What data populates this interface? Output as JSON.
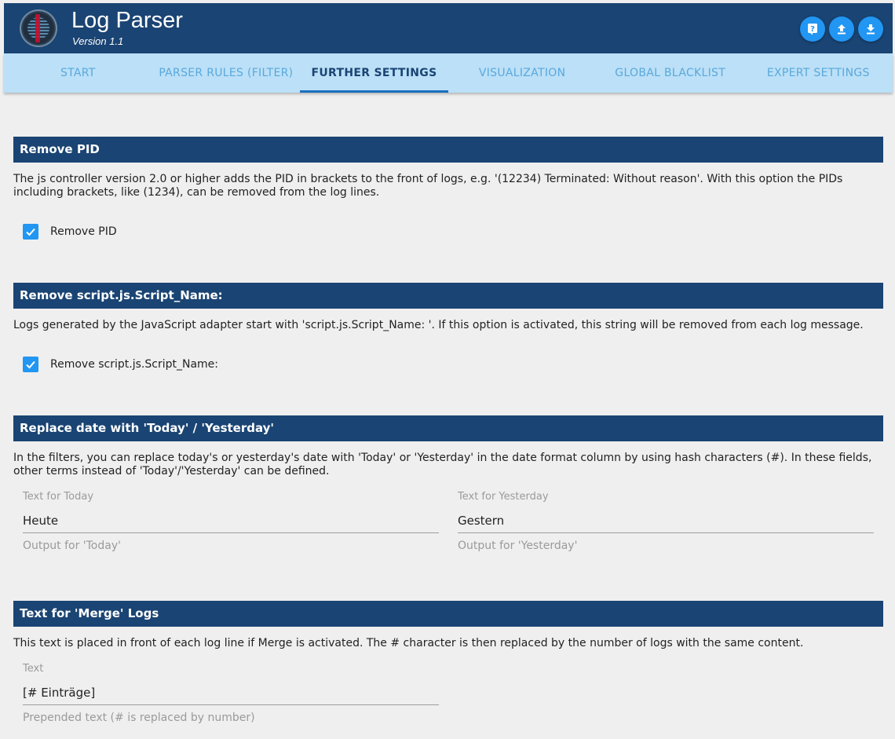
{
  "app": {
    "title": "Log Parser",
    "version": "Version 1.1"
  },
  "header_buttons": [
    {
      "name": "help",
      "icon": "help-icon"
    },
    {
      "name": "upload",
      "icon": "upload-icon"
    },
    {
      "name": "download",
      "icon": "download-icon"
    }
  ],
  "tabs": [
    {
      "label": "START",
      "active": false
    },
    {
      "label": "PARSER RULES (FILTER)",
      "active": false
    },
    {
      "label": "FURTHER SETTINGS",
      "active": true
    },
    {
      "label": "VISUALIZATION",
      "active": false
    },
    {
      "label": "GLOBAL BLACKLIST",
      "active": false
    },
    {
      "label": "EXPERT SETTINGS",
      "active": false
    }
  ],
  "sections": {
    "remove_pid": {
      "title": "Remove PID",
      "description": "The js controller version 2.0 or higher adds the PID in brackets to the front of logs, e.g. '(12234) Terminated: Without reason'. With this option the PIDs including brackets, like (1234), can be removed from the log lines.",
      "checkbox_label": "Remove PID",
      "checked": true
    },
    "remove_script": {
      "title": "Remove script.js.Script_Name:",
      "description": "Logs generated by the JavaScript adapter start with 'script.js.Script_Name: '. If this option is activated, this string will be removed from each log message.",
      "checkbox_label": "Remove script.js.Script_Name:",
      "checked": true
    },
    "replace_date": {
      "title": "Replace date with 'Today' / 'Yesterday'",
      "description": "In the filters, you can replace today's or yesterday's date with 'Today' or 'Yesterday' in the date format column by using hash characters (#). In these fields, other terms instead of 'Today'/'Yesterday' can be defined.",
      "today": {
        "label": "Text for Today",
        "value": "Heute",
        "help": "Output for 'Today'"
      },
      "yesterday": {
        "label": "Text for Yesterday",
        "value": "Gestern",
        "help": "Output for 'Yesterday'"
      }
    },
    "merge": {
      "title": "Text for 'Merge' Logs",
      "description": "This text is placed in front of each log line if Merge is activated. The # character is then replaced by the number of logs with the same content.",
      "field": {
        "label": "Text",
        "value": "[# Einträge]",
        "help": "Prepended text (# is replaced by number)"
      }
    }
  },
  "colors": {
    "header": "#1a4473",
    "tabbar": "#bbe0f7",
    "accent": "#2196f3",
    "tab_inactive": "#5aa8dc"
  }
}
